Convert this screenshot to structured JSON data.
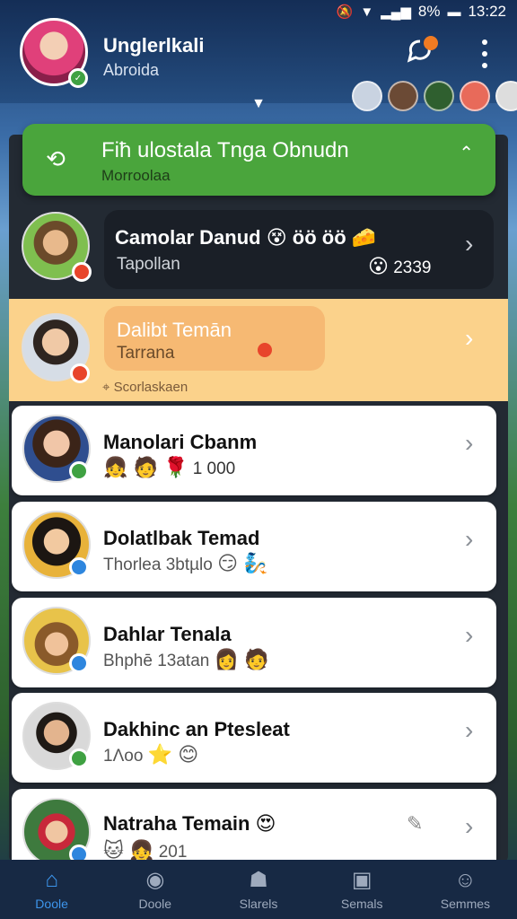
{
  "status_bar": {
    "battery": "8%",
    "time": "13:22"
  },
  "header": {
    "name": "Unglerlkali",
    "subtitle": "Abroida"
  },
  "banner": {
    "title": "Fiħ ulostala Tnga Obnudn",
    "subtitle": "Morroolaa"
  },
  "rows": [
    {
      "name": "Camolar Danud",
      "name_emojis": "😵 ö‍ö ö‍ö 🧀",
      "sub": "Tapollan",
      "meta_emoji": "😮",
      "meta": "2339"
    },
    {
      "name": "Dalibt Temān",
      "sub": "Tarrana",
      "hint": "Scorlaskaen"
    },
    {
      "name": "Manolari Cbanm",
      "sub": "1",
      "sub_emojis": "👧 🧑 🌹",
      "meta": "000"
    },
    {
      "name": "Dolatlbak Temad",
      "sub": "Thorlea 3btµlo",
      "sub_emojis": "😏 🧞"
    },
    {
      "name": "Dahlar Tenala",
      "sub": "Bhphē 13atan",
      "sub_emojis": "👩 🧑"
    },
    {
      "name": "Dakhinc an Ptesleat",
      "sub": "1Λoo",
      "sub_emojis": "⭐ 😊"
    },
    {
      "name": "Natraha Temain",
      "name_emojis": "😍",
      "sub": "201",
      "sub_emojis": "🐱 👧"
    }
  ],
  "tabs": [
    {
      "label": "Doole",
      "icon": "home-icon",
      "active": true
    },
    {
      "label": "Doole",
      "icon": "chat-bubble-icon",
      "active": false
    },
    {
      "label": "Slarels",
      "icon": "person-icon",
      "active": false
    },
    {
      "label": "Semals",
      "icon": "card-icon",
      "active": false
    },
    {
      "label": "Semmes",
      "icon": "profile-icon",
      "active": false
    }
  ]
}
